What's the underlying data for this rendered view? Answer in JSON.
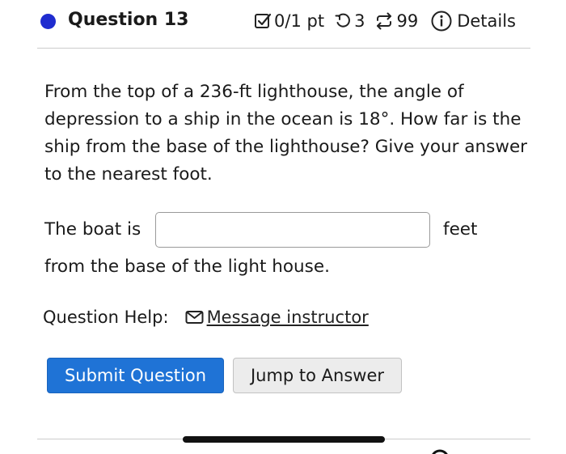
{
  "header": {
    "question_title": "Question 13",
    "score": "0/1 pt",
    "attempts": "3",
    "versions": "99",
    "details_label": "Details",
    "colors": {
      "status_dot": "#1f2ccf"
    }
  },
  "question": {
    "text": "From the top of a 236-ft lighthouse, the angle of depression to a ship in the ocean is 18°. How far is the ship from the base of the lighthouse? Give your answer to the nearest foot.",
    "answer_prefix": "The boat is",
    "answer_value": "",
    "answer_unit": "feet",
    "answer_suffix": "from the base of the light house."
  },
  "help": {
    "label": "Question Help:",
    "message_link": "Message instructor"
  },
  "actions": {
    "submit_label": "Submit Question",
    "jump_label": "Jump to Answer",
    "colors": {
      "submit_bg": "#1f73d6",
      "jump_bg": "#ececec"
    }
  }
}
